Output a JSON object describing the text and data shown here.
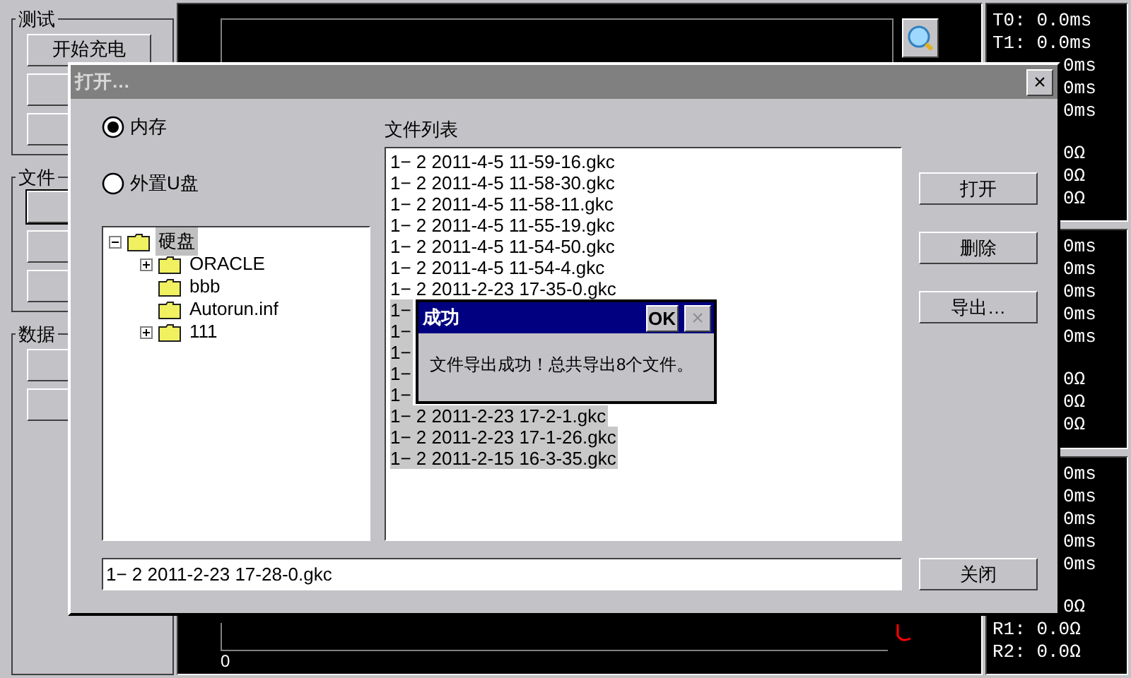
{
  "side_panel": {
    "groups": [
      {
        "label": "测试",
        "buttons": [
          {
            "label": "开始充电",
            "default": false
          },
          {
            "default": false
          },
          {
            "default": false
          }
        ]
      },
      {
        "label": "文件",
        "buttons": [
          {
            "default": true
          },
          {
            "default": false
          },
          {
            "default": false
          }
        ]
      },
      {
        "label": "数据",
        "buttons": [
          {
            "default": false
          },
          {
            "default": false
          }
        ]
      }
    ]
  },
  "plot": {
    "axis_label": "0"
  },
  "readouts": [
    {
      "times": [
        {
          "text": "T0: 0.0ms",
          "kind": "full"
        },
        {
          "text": "T1: 0.0ms",
          "kind": "full"
        },
        {
          "text": "0ms",
          "kind": "tail"
        },
        {
          "text": "0ms",
          "kind": "tail"
        },
        {
          "text": "0ms",
          "kind": "tail"
        }
      ],
      "ohms": [
        {
          "text": "0Ω",
          "kind": "tail"
        },
        {
          "text": "0Ω",
          "kind": "tail"
        },
        {
          "text": "0Ω",
          "kind": "tail"
        }
      ]
    },
    {
      "times": [
        {
          "text": "0ms",
          "kind": "tail"
        },
        {
          "text": "0ms",
          "kind": "tail"
        },
        {
          "text": "0ms",
          "kind": "tail"
        },
        {
          "text": "0ms",
          "kind": "tail"
        },
        {
          "text": "0ms",
          "kind": "tail"
        }
      ],
      "ohms": [
        {
          "text": "0Ω",
          "kind": "tail"
        },
        {
          "text": "0Ω",
          "kind": "tail"
        },
        {
          "text": "0Ω",
          "kind": "tail"
        }
      ]
    },
    {
      "times": [
        {
          "text": "0ms",
          "kind": "tail"
        },
        {
          "text": "0ms",
          "kind": "tail"
        },
        {
          "text": "0ms",
          "kind": "tail"
        },
        {
          "text": "0ms",
          "kind": "tail"
        },
        {
          "text": "0ms",
          "kind": "tail"
        }
      ],
      "ohms": [
        {
          "text": "0Ω",
          "kind": "tail"
        },
        {
          "text": "R1: 0.0Ω",
          "kind": "full"
        },
        {
          "text": "R2: 0.0Ω",
          "kind": "full"
        }
      ]
    }
  ],
  "dialog": {
    "title": "打开…",
    "close": "×",
    "sources": [
      {
        "label": "内存",
        "selected": true
      },
      {
        "label": "外置U盘",
        "selected": false
      }
    ],
    "tree": [
      {
        "label": "硬盘",
        "expanded": true,
        "selected": true,
        "children": [
          {
            "label": "ORACLE",
            "expanded": false,
            "selected": false
          },
          {
            "label": "bbb",
            "selected": false
          },
          {
            "label": "Autorun.inf",
            "selected": false
          },
          {
            "label": "111",
            "expanded": false,
            "selected": false
          }
        ]
      }
    ],
    "file_list_label": "文件列表",
    "files": [
      {
        "name": "1− 2 2011-4-5 11-59-16.gkc",
        "selected": false
      },
      {
        "name": "1− 2 2011-4-5 11-58-30.gkc",
        "selected": false
      },
      {
        "name": "1− 2 2011-4-5 11-58-11.gkc",
        "selected": false
      },
      {
        "name": "1− 2 2011-4-5 11-55-19.gkc",
        "selected": false
      },
      {
        "name": "1− 2 2011-4-5 11-54-50.gkc",
        "selected": false
      },
      {
        "name": "1− 2 2011-4-5 11-54-4.gkc",
        "selected": false
      },
      {
        "name": "1− 2 2011-2-23 17-35-0.gkc",
        "selected": false
      },
      {
        "name": "1−",
        "selected": true
      },
      {
        "name": "1−",
        "selected": true
      },
      {
        "name": "1−",
        "selected": true
      },
      {
        "name": "1−",
        "selected": true
      },
      {
        "name": "1−",
        "selected": true
      },
      {
        "name": "1− 2 2011-2-23 17-2-1.gkc",
        "selected": true
      },
      {
        "name": "1− 2 2011-2-23 17-1-26.gkc",
        "selected": true
      },
      {
        "name": "1− 2 2011-2-15 16-3-35.gkc",
        "selected": true
      }
    ],
    "buttons": [
      "打开",
      "删除",
      "导出…"
    ],
    "filename": "1− 2 2011-2-23 17-28-0.gkc",
    "close_button": "关闭"
  },
  "message": {
    "title": "成功",
    "ok": "OK",
    "close": "×",
    "close_disabled": true,
    "text": "文件导出成功！总共导出8个文件。"
  }
}
